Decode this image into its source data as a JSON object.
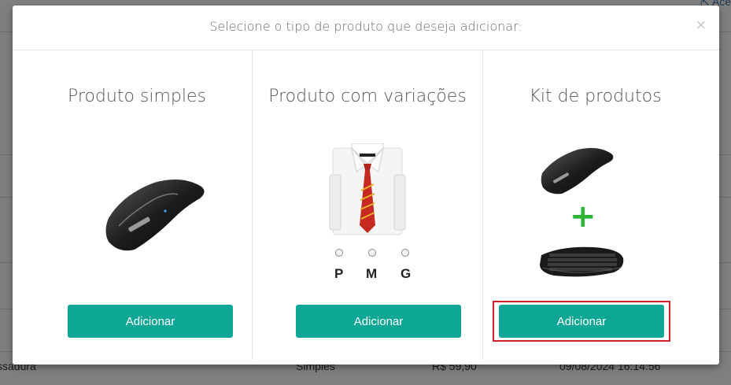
{
  "background": {
    "top_right_link": "Ace",
    "row": {
      "category": "ssadura",
      "type": "Simples",
      "price": "R$ 59,90",
      "datetime": "09/08/2024 16:14:56"
    }
  },
  "modal": {
    "title": "Selecione o tipo de produto que deseja adicionar:",
    "close_glyph": "×",
    "options": [
      {
        "title": "Produto simples",
        "button": "Adicionar",
        "image_icon": "mouse-icon"
      },
      {
        "title": "Produto com variações",
        "button": "Adicionar",
        "image_icon": "shirt-tie-icon",
        "sizes": [
          "P",
          "M",
          "G"
        ]
      },
      {
        "title": "Kit de produtos",
        "button": "Adicionar",
        "image_icon": "mouse-plus-keyboard-icon",
        "plus_glyph": "+"
      }
    ]
  },
  "colors": {
    "accent": "#0ea694",
    "highlight": "#d6202a",
    "plus": "#2db335"
  }
}
